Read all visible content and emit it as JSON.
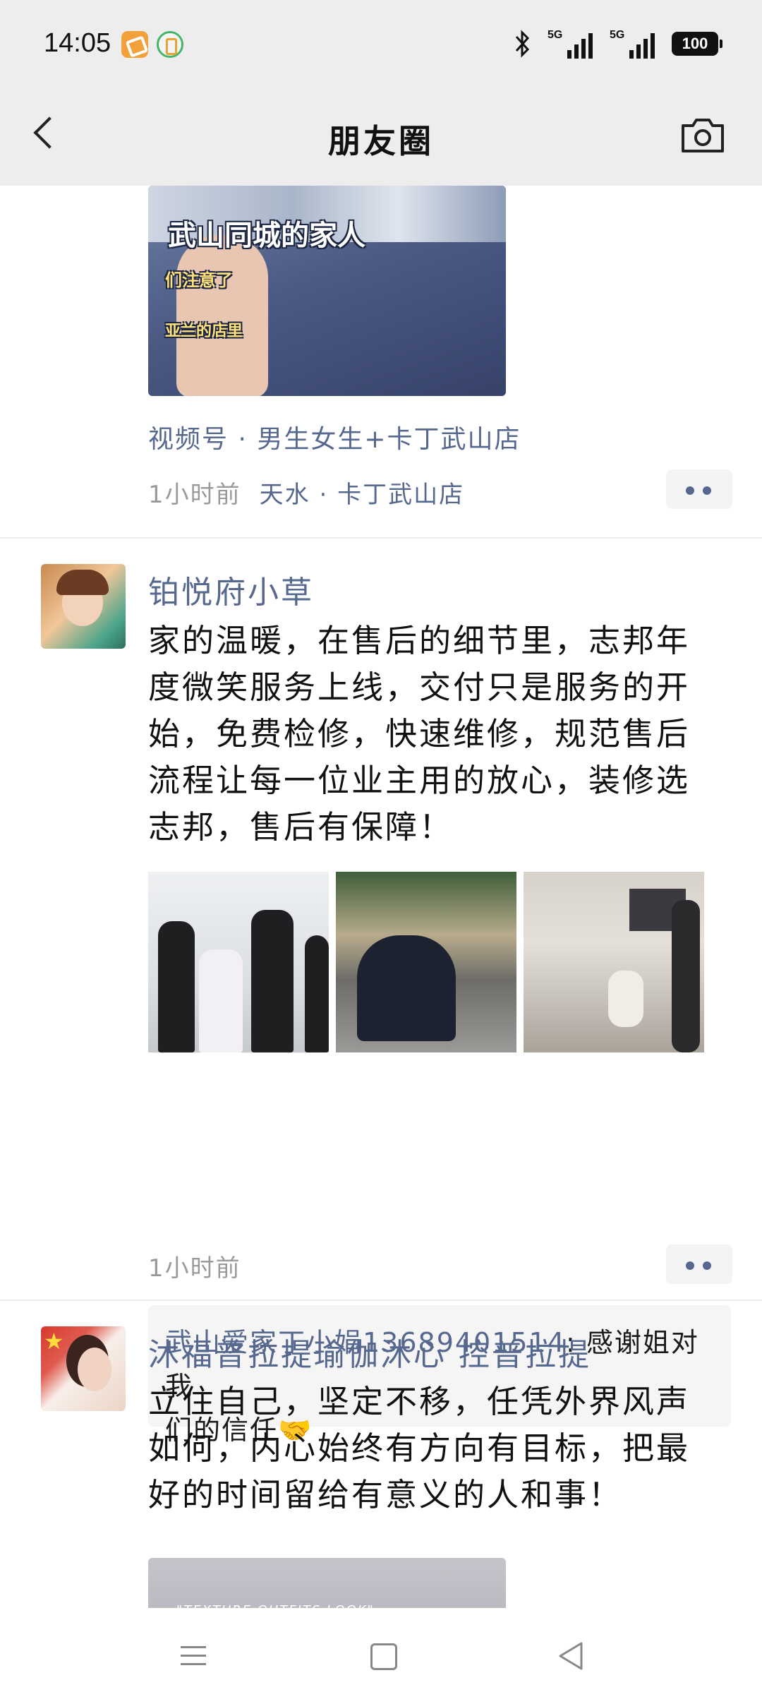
{
  "status_bar": {
    "time": "14:05",
    "network_1": "5G",
    "network_2": "5G",
    "battery": "100"
  },
  "nav": {
    "title": "朋友圈"
  },
  "posts": [
    {
      "video_captions": [
        "武山同城的家人",
        "们注意了",
        "亚兰的店里"
      ],
      "channel_link": "视频号 · 男生女生+卡丁武山店",
      "time": "1小时前",
      "location": "天水 · 卡丁武山店"
    },
    {
      "username": "铂悦府小草",
      "text_lines": [
        "家的温暖，在售后的细节里，志邦年",
        "度微笑服务上线，交付只是服务的开",
        "始，免费检修，快速维修，规范售后",
        "流程让每一位业主用的放心，装修选",
        "志邦，售后有保障！"
      ],
      "time": "1小时前",
      "comment": {
        "author": "武山爱家丁小娟13689401514",
        "separator": ": ",
        "text_line1": "感谢姐对我",
        "text_line2": "们的信任🤝"
      }
    },
    {
      "username": "沐福普拉提瑜伽沐心 控普拉提",
      "text_lines": [
        "立住自己，坚定不移，任凭外界风声",
        "如何，内心始终有方向有目标，把最",
        "好的时间留给有意义的人和事！"
      ],
      "video_caption": "\"TEXTURE OUTFITS LOOK\""
    }
  ],
  "icons": {
    "back": "chevron-left-icon",
    "camera": "camera-icon",
    "more": "more-dots-icon",
    "menu": "menu-icon",
    "home": "home-square-icon",
    "nav_back": "triangle-back-icon"
  },
  "colors": {
    "link": "#57688f",
    "header_bg": "#ededed",
    "comment_bg": "#f5f5f5",
    "meta_gray": "#9a9a9a"
  }
}
